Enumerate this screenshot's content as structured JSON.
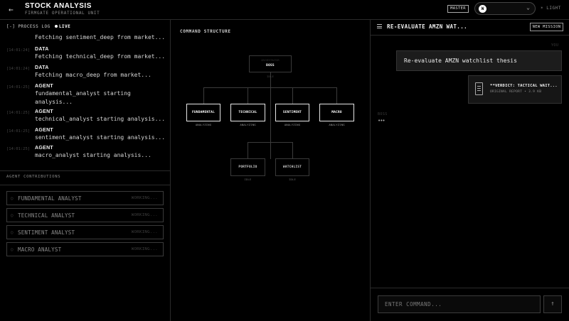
{
  "header": {
    "back_icon": "arrow-left-icon",
    "title": "STOCK ANALYSIS",
    "subtitle": "FIRMGATE OPERATIONAL UNIT",
    "mode_badge": "MASTER",
    "selector_initial": "W",
    "selector_icon": "chevron-down-icon",
    "theme_toggle": "☀ LIGHT"
  },
  "process_log": {
    "header_prefix": "[-] PROCESS LOG",
    "live_label": "LIVE",
    "entries": [
      {
        "time": "",
        "type": "",
        "lines": [
          "Fetching sentiment_deep from market..."
        ]
      },
      {
        "time": "[14:01:24]",
        "type": "DATA",
        "lines": [
          "Fetching technical_deep from market..."
        ]
      },
      {
        "time": "[14:01:24]",
        "type": "DATA",
        "lines": [
          "Fetching macro_deep from market..."
        ]
      },
      {
        "time": "[14:01:25]",
        "type": "AGENT",
        "lines": [
          "fundamental_analyst starting",
          "analysis..."
        ]
      },
      {
        "time": "[14:01:25]",
        "type": "AGENT",
        "lines": [
          "technical_analyst starting analysis..."
        ]
      },
      {
        "time": "[14:01:25]",
        "type": "AGENT",
        "lines": [
          "sentiment_analyst starting analysis..."
        ]
      },
      {
        "time": "[14:01:25]",
        "type": "AGENT",
        "lines": [
          "macro_analyst starting analysis..."
        ]
      }
    ]
  },
  "contributions": {
    "header": "AGENT CONTRIBUTIONS",
    "agents": [
      {
        "name": "FUNDAMENTAL ANALYST",
        "status": "WORKING..."
      },
      {
        "name": "TECHNICAL ANALYST",
        "status": "WORKING..."
      },
      {
        "name": "SENTIMENT ANALYST",
        "status": "WORKING..."
      },
      {
        "name": "MACRO ANALYST",
        "status": "WORKING..."
      }
    ]
  },
  "command_structure": {
    "header": "COMMAND STRUCTURE",
    "boss": {
      "faint": "ORCHESTRATOR",
      "label": "BOSS",
      "sub": "IDLE"
    },
    "analysts": [
      {
        "label": "FUNDAMENTAL",
        "status": "ANALYZING"
      },
      {
        "label": "TECHNICAL",
        "status": "ANALYZING"
      },
      {
        "label": "SENTIMENT",
        "status": "ANALYZING"
      },
      {
        "label": "MACRO",
        "status": "ANALYZING"
      }
    ],
    "bottom": [
      {
        "label": "PORTFOLIO",
        "status": "IDLE"
      },
      {
        "label": "WATCHLIST",
        "status": "IDLE"
      }
    ]
  },
  "mission": {
    "menu_icon": "hamburger-menu-icon",
    "title": "RE-EVALUATE AMZN WAT...",
    "new_mission_label": "NEW MISSION",
    "you_label": "YOU",
    "user_message": "Re-evaluate AMZN watchlist thesis",
    "report_icon": "document-icon",
    "report_title": "**VERDICT: TACTICAL WAIT...",
    "report_sub": "ORIGINAL REPORT • 3.9 KB",
    "boss_label": "BOSS",
    "typing": "•••",
    "input_placeholder": "ENTER COMMAND...",
    "send_icon": "arrow-up-icon",
    "send_label": "↑"
  }
}
